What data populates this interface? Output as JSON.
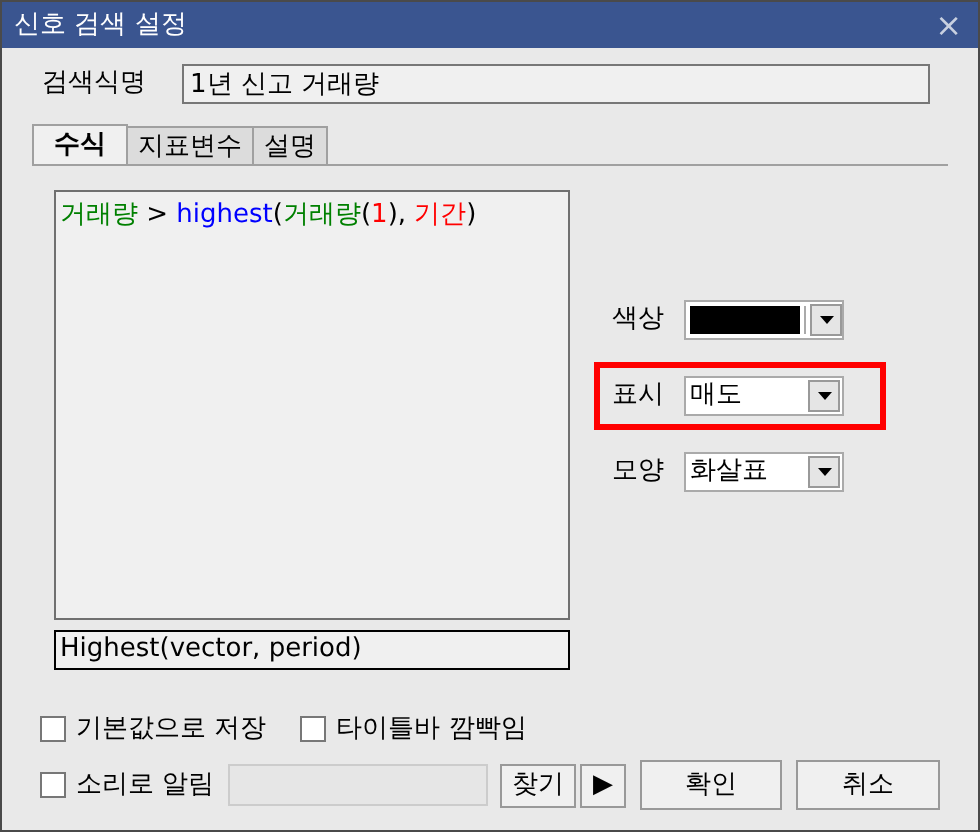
{
  "window": {
    "title": "신호 검색 설정",
    "close": "×"
  },
  "name_field": {
    "label": "검색식명",
    "value": "1년 신고 거래량"
  },
  "tabs": [
    {
      "label": "수식",
      "selected": true
    },
    {
      "label": "지표변수",
      "selected": false
    },
    {
      "label": "설명",
      "selected": false
    }
  ],
  "formula": [
    {
      "text": "거래량",
      "color": "#008000"
    },
    {
      "text": " > ",
      "color": "#000000"
    },
    {
      "text": "highest",
      "color": "#0000ff"
    },
    {
      "text": "(",
      "color": "#000000"
    },
    {
      "text": "거래량",
      "color": "#008000"
    },
    {
      "text": "(",
      "color": "#000000"
    },
    {
      "text": "1",
      "color": "#ff0000"
    },
    {
      "text": "), ",
      "color": "#000000"
    },
    {
      "text": "기간",
      "color": "#ff0000"
    },
    {
      "text": ")",
      "color": "#000000"
    }
  ],
  "hint": "Highest(vector, period)",
  "options": [
    {
      "kind": "color",
      "label": "색상",
      "color": "#000000",
      "highlighted": false
    },
    {
      "kind": "select",
      "label": "표시",
      "value": "매도",
      "highlighted": true
    },
    {
      "kind": "select",
      "label": "모양",
      "value": "화살표",
      "highlighted": false
    }
  ],
  "checkboxes": [
    {
      "label": "기본값으로 저장",
      "checked": false
    },
    {
      "label": "타이틀바 깜빡임",
      "checked": false
    },
    {
      "label": "소리로 알림",
      "checked": false
    }
  ],
  "find_button": "찾기",
  "play_button": "▶",
  "buttons": [
    "확인",
    "취소"
  ]
}
